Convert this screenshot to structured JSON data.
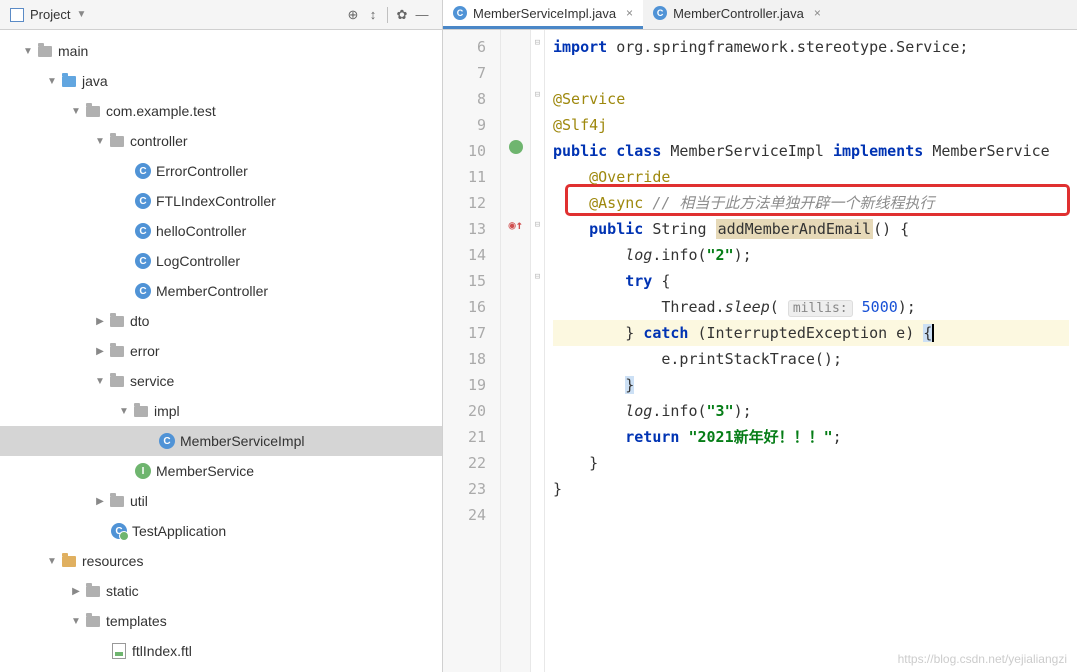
{
  "project_header": {
    "title": "Project"
  },
  "tree": {
    "main": "main",
    "java": "java",
    "package": "com.example.test",
    "controller": "controller",
    "controllers": [
      "ErrorController",
      "FTLIndexController",
      "helloController",
      "LogController",
      "MemberController"
    ],
    "dto": "dto",
    "error": "error",
    "service": "service",
    "impl": "impl",
    "impl_class": "MemberServiceImpl",
    "service_interface": "MemberService",
    "util": "util",
    "app": "TestApplication",
    "resources": "resources",
    "static": "static",
    "templates": "templates",
    "ftl": "ftlIndex.ftl"
  },
  "tabs": [
    {
      "label": "MemberServiceImpl.java",
      "active": true
    },
    {
      "label": "MemberController.java",
      "active": false
    }
  ],
  "code": {
    "lines_start": 6,
    "import_kw": "import ",
    "import_pkg": "org.springframework.stereotype.Service;",
    "ann_service": "@Service",
    "ann_slf4j": "@Slf4j",
    "public": "public ",
    "class_kw": "class ",
    "class_name": "MemberServiceImpl ",
    "implements": "implements ",
    "impl_type": "MemberService",
    "override": "@Override",
    "async": "@Async",
    "async_comment": " // 相当于此方法单独开辟一个新线程执行",
    "method_sig_pre": "String ",
    "method_name": "addMemberAndEmail",
    "method_sig_post": "() {",
    "log_info_2": ".info(",
    "log_var": "log",
    "str_2": "\"2\"",
    "try": "try ",
    "thread_sleep": "Thread.",
    "sleep": "sleep",
    "millis_hint": "millis:",
    "millis_val": " 5000",
    "catch": "catch ",
    "catch_type": "(InterruptedException e) ",
    "print_stack": "e.printStackTrace();",
    "str_3": "\"3\"",
    "return": "return ",
    "return_str": "\"2021新年好！！！\"",
    "line_numbers": [
      "6",
      "7",
      "8",
      "9",
      "10",
      "11",
      "12",
      "13",
      "14",
      "15",
      "16",
      "17",
      "18",
      "19",
      "20",
      "21",
      "22",
      "23",
      "24"
    ]
  },
  "watermark": "https://blog.csdn.net/yejialiangzi"
}
